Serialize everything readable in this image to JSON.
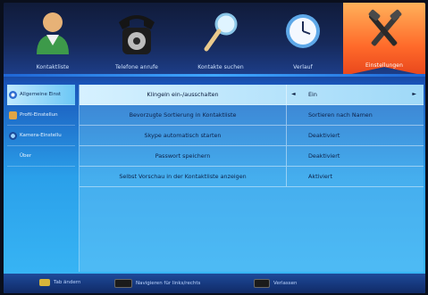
{
  "tabs": [
    {
      "label": "Kontaktliste",
      "icon": "contact-person-icon",
      "active": false
    },
    {
      "label": "Telefone anrufe",
      "icon": "telephone-icon",
      "active": false
    },
    {
      "label": "Kontakte suchen",
      "icon": "magnifier-icon",
      "active": false
    },
    {
      "label": "Verlauf",
      "icon": "clock-icon",
      "active": false
    },
    {
      "label": "Einstellungen",
      "icon": "tools-icon",
      "active": true
    }
  ],
  "sidebar": {
    "items": [
      {
        "label": "Allgemeine Einst",
        "icon": "general-settings-icon",
        "active": true
      },
      {
        "label": "Profil-Einstellun",
        "icon": "profile-icon",
        "active": false
      },
      {
        "label": "Kamera-Einstellu",
        "icon": "camera-icon",
        "active": false
      },
      {
        "label": "Über",
        "icon": "info-icon",
        "active": false
      }
    ]
  },
  "settings": {
    "rows": [
      {
        "label": "Klingeln ein-/ausschalten",
        "value": "Ein",
        "selected": true
      },
      {
        "label": "Bevorzugte Sortierung in Kontaktliste",
        "value": "Sortieren nach Namen",
        "selected": false
      },
      {
        "label": "Skype automatisch starten",
        "value": "Deaktiviert",
        "selected": false
      },
      {
        "label": "Passwort speichern",
        "value": "Deaktiviert",
        "selected": false
      },
      {
        "label": "Selbst Vorschau in der Kontaktliste anzeigen",
        "value": "Aktiviert",
        "selected": false
      }
    ],
    "left_arrow": "◄",
    "right_arrow": "►"
  },
  "footer": {
    "items": [
      {
        "label": "Tab ändern",
        "key_color": "#d7b43a"
      },
      {
        "label": "Navigieren für links/rechts",
        "key_color": "#1b1b1b"
      },
      {
        "label": "Verlassen",
        "key_color": "#1b1b1b"
      }
    ]
  },
  "colors": {
    "active_tab": "#ff6a2a",
    "background_top": "#16307a",
    "background_bottom": "#3ab8f6",
    "selected_row": "#c5eafc"
  }
}
